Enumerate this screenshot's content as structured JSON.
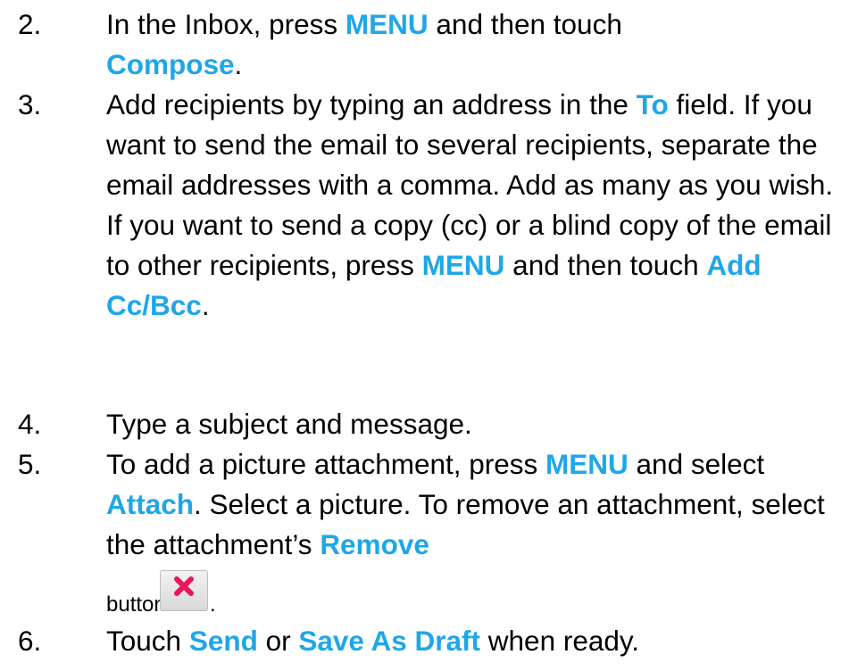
{
  "colors": {
    "keyword": "#1ea7e8",
    "text": "#000000",
    "remove_icon_x": "#e8175d"
  },
  "steps": [
    {
      "number": "2.",
      "parts": [
        "In the Inbox, press ",
        "MENU",
        " and then touch ",
        "Compose",
        "."
      ]
    },
    {
      "number": "3.",
      "parts": [
        "Add recipients by typing an address in the ",
        "To",
        " field. If you want to send the email to several recipients, separate the email addresses with a comma. Add as many as you wish."
      ],
      "parts2": [
        "If you want to send a copy (cc) or a blind copy of the email to other recipients, press ",
        "MENU",
        " and then touch ",
        "Add Cc/Bcc",
        "."
      ]
    },
    {
      "number": "4.",
      "text": "Type a subject and message."
    },
    {
      "number": "5.",
      "parts": [
        "To add a picture attachment, press ",
        "MENU",
        " and select ",
        "Attach",
        ". Select a picture. To remove an attachment, select the attachment’s ",
        "Remove"
      ],
      "button_word": "button",
      "icon": "remove-x-icon",
      "period": "."
    },
    {
      "number": "6.",
      "parts": [
        "Touch ",
        "Send",
        " or ",
        "Save As Draft",
        " when ready."
      ]
    }
  ]
}
